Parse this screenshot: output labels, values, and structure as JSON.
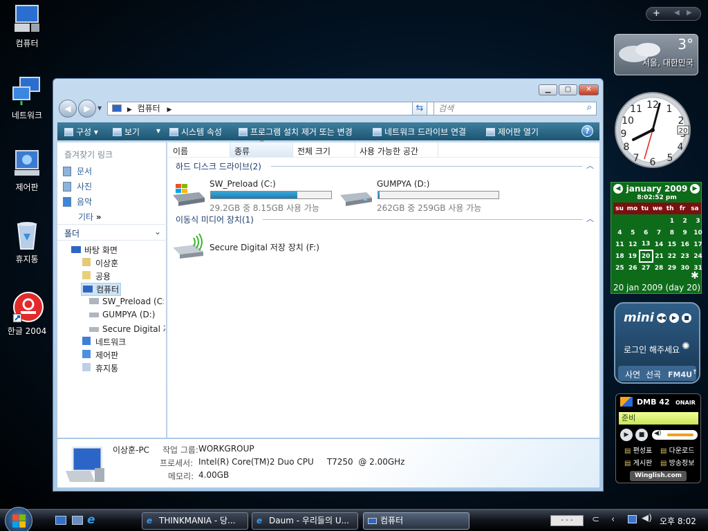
{
  "desktop": {
    "icons": [
      "컴퓨터",
      "네트워크",
      "제어판",
      "휴지통",
      "한글 2004"
    ]
  },
  "window": {
    "address": [
      "컴퓨터"
    ],
    "search_placeholder": "검색",
    "toolbar": [
      "구성",
      "보기",
      "시스템 속성",
      "프로그램 설치 제거 또는 변경",
      "네트워크 드라이브 연결",
      "제어판 열기"
    ],
    "nav": {
      "fav_title": "즐겨찾기 링크",
      "links": [
        "문서",
        "사진",
        "음악"
      ],
      "more": "기타",
      "folders_title": "폴더",
      "tree": [
        "바탕 화면",
        "이상훈",
        "공용",
        "컴퓨터",
        "SW_Preload (C:)",
        "GUMPYA (D:)",
        "Secure Digital 저:",
        "네트워크",
        "제어판",
        "휴지통"
      ]
    },
    "columns": [
      "이름",
      "종류",
      "전체 크기",
      "사용 가능한 공간"
    ],
    "groups": {
      "hdd": "하드 디스크 드라이브(2)",
      "removable": "이동식 미디어 장치(1)"
    },
    "drives": [
      {
        "name": "SW_Preload (C:)",
        "space": "29.2GB 중 8.15GB 사용 가능",
        "used_fraction": 0.72
      },
      {
        "name": "GUMPYA (D:)",
        "space": "262GB 중 259GB 사용 가능",
        "used_fraction": 0.01
      }
    ],
    "removable": "Secure Digital 저장 장치 (F:)",
    "details": {
      "pc": "이상훈-PC",
      "workgroup_label": "작업 그룹:",
      "workgroup": "WORKGROUP",
      "cpu_label": "프로세서:",
      "cpu": "Intel(R) Core(TM)2 Duo CPU     T7250  @ 2.00GHz",
      "mem_label": "메모리:",
      "mem": "4.00GB"
    }
  },
  "gadgets": {
    "weather": {
      "temp": "3°",
      "location": "서울, 대한민국"
    },
    "clock": {
      "date": "20"
    },
    "calendar": {
      "month": "january 2009",
      "time": "8:02:52 pm",
      "days": [
        "su",
        "mo",
        "tu",
        "we",
        "th",
        "fr",
        "sa"
      ],
      "weeks": [
        [
          "",
          "",
          "",
          "",
          "1",
          "2",
          "3"
        ],
        [
          "4",
          "5",
          "6",
          "7",
          "8",
          "9",
          "10"
        ],
        [
          "11",
          "12",
          "13",
          "14",
          "15",
          "16",
          "17"
        ],
        [
          "18",
          "19",
          "20",
          "21",
          "22",
          "23",
          "24"
        ],
        [
          "25",
          "26",
          "27",
          "28",
          "29",
          "30",
          "31"
        ]
      ],
      "footer": "20 jan 2009 (day 20)"
    },
    "mini": {
      "logo": "mini",
      "login": "로그인 해주세요",
      "tabs": [
        "사연",
        "선곡",
        "FM4U"
      ]
    },
    "dmb": {
      "title": "DMB 42",
      "onair": "ONAIR",
      "status": "준비",
      "menu": [
        "편성표",
        "다운로드",
        "게시판",
        "방송정보"
      ],
      "footer": "Winglish.com"
    }
  },
  "taskbar": {
    "buttons": [
      "THINKMANIA - 당...",
      "Daum - 우리들의 U...",
      "컴퓨터"
    ],
    "clock": "오후 8:02",
    "tray_box": "- - -"
  }
}
